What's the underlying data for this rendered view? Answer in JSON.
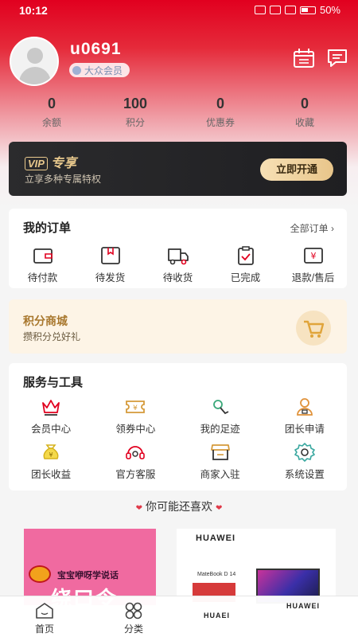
{
  "status_bar": {
    "time": "10:12",
    "battery": "50%"
  },
  "profile": {
    "username": "u0691",
    "member_level": "大众会员"
  },
  "stats": [
    {
      "value": "0",
      "label": "余额"
    },
    {
      "value": "100",
      "label": "积分"
    },
    {
      "value": "0",
      "label": "优惠券"
    },
    {
      "value": "0",
      "label": "收藏"
    }
  ],
  "vip": {
    "badge": "VIP",
    "title": "专享",
    "subtitle": "立享多种专属特权",
    "button": "立即开通"
  },
  "orders": {
    "title": "我的订单",
    "all_link": "全部订单",
    "items": [
      {
        "label": "待付款",
        "icon": "wallet-icon"
      },
      {
        "label": "待发货",
        "icon": "package-icon"
      },
      {
        "label": "待收货",
        "icon": "truck-icon"
      },
      {
        "label": "已完成",
        "icon": "clipboard-check-icon"
      },
      {
        "label": "退款/售后",
        "icon": "refund-icon"
      }
    ]
  },
  "points_mall": {
    "title": "积分商城",
    "subtitle": "攒积分兑好礼"
  },
  "services": {
    "title": "服务与工具",
    "items": [
      {
        "label": "会员中心",
        "icon": "crown-icon"
      },
      {
        "label": "领券中心",
        "icon": "coupon-icon"
      },
      {
        "label": "我的足迹",
        "icon": "footprint-icon"
      },
      {
        "label": "团长申请",
        "icon": "leader-icon"
      },
      {
        "label": "团长收益",
        "icon": "money-bag-icon"
      },
      {
        "label": "官方客服",
        "icon": "headset-icon"
      },
      {
        "label": "商家入驻",
        "icon": "shop-icon"
      },
      {
        "label": "系统设置",
        "icon": "gear-icon"
      }
    ]
  },
  "recommend": {
    "title": "你可能还喜欢"
  },
  "products": [
    {
      "text": "宝宝咿呀学说话",
      "big_text": "绕口令"
    },
    {
      "brand": "HUAWEI",
      "model": "MateBook D 14"
    }
  ],
  "behind_brands": [
    "HUAEI",
    "HUAWEI"
  ],
  "tabbar": [
    {
      "label": "首页",
      "icon": "home-icon"
    },
    {
      "label": "分类",
      "icon": "category-icon"
    }
  ],
  "colors": {
    "brand_red": "#e1001f",
    "vip_gold": "#e9c98d",
    "points_brown": "#a8772d"
  }
}
